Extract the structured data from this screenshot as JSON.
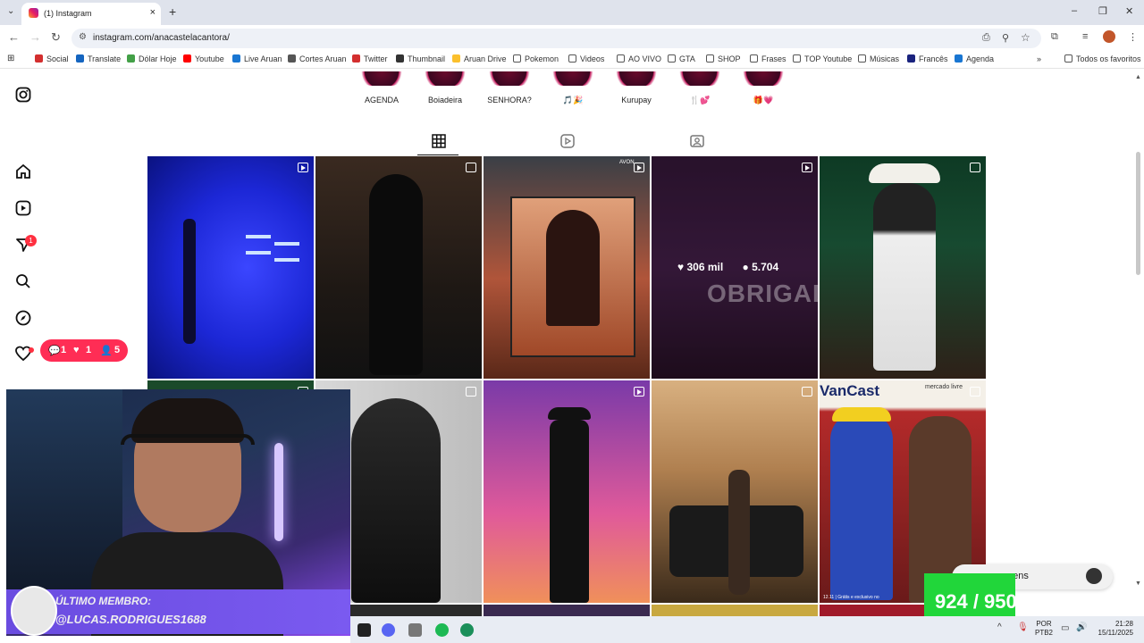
{
  "browser": {
    "tab_title": "(1) Instagram",
    "url": "instagram.com/anacastelacantora/",
    "bookmarks": [
      "Social",
      "Translate",
      "Dólar Hoje",
      "Youtube",
      "Live Aruan",
      "Cortes Aruan",
      "Twitter",
      "Thumbnail",
      "Aruan Drive",
      "Pokemon",
      "Videos",
      "AO VIVO",
      "GTA",
      "SHOP",
      "Frases",
      "TOP Youtube",
      "Músicas",
      "Francês",
      "Agenda"
    ],
    "all_bookmarks": "Todos os favoritos",
    "bookmark_colors": [
      "#d32f2f",
      "#1565c0",
      "#43a047",
      "#ff0000",
      "#1976d2",
      "#555",
      "#d32f2f",
      "#333",
      "#fbc02d",
      "#555",
      "#555",
      "#555",
      "#555",
      "#555",
      "#555",
      "#555",
      "#555",
      "#1a237e",
      "#1976d2"
    ]
  },
  "profile": {
    "highlights": [
      {
        "label": "AGENDA"
      },
      {
        "label": "Boiadeira"
      },
      {
        "label": "SENHORA?"
      },
      {
        "label": "🎵🎉"
      },
      {
        "label": "Kurupay"
      },
      {
        "label": "🍴💕"
      },
      {
        "label": "🎁💗"
      }
    ],
    "tabs": [
      "posts-grid",
      "reels",
      "tagged"
    ],
    "hover_post": {
      "likes": "306 mil",
      "comments": "5.704"
    }
  },
  "grid": {
    "posts": [
      {
        "type": "reel",
        "bg": "#1c27d6"
      },
      {
        "type": "carousel",
        "bg": "#2b2420"
      },
      {
        "type": "reel",
        "bg": "#8b4a2a",
        "brand": "AVON"
      },
      {
        "type": "reel",
        "bg": "#4a2250",
        "overlay_text": "OBRIGADA"
      },
      {
        "type": "carousel",
        "bg": "#0e3a24"
      },
      {
        "type": "reel",
        "bg": "#1a4a2a"
      },
      {
        "type": "carousel",
        "bg": "#cfcfcf"
      },
      {
        "type": "reel",
        "bg": "#e05a9a"
      },
      {
        "type": "carousel",
        "bg": "#b08050"
      },
      {
        "type": "reel",
        "bg": "#b42a2a",
        "title": "VanCast",
        "sponsor": "mercado livre",
        "footer": "12.11 | Grátis e exclusivo no"
      }
    ]
  },
  "notifications": {
    "comments": "1",
    "likes": "1",
    "follows": "5"
  },
  "rail": {
    "badge": "1"
  },
  "overlay": {
    "member_label": "ÚLTIMO MEMBRO:",
    "member_name": "@LUCAS.RODRIGUES1688",
    "counter": "924 / 950",
    "message_pill": "gens"
  },
  "taskbar": {
    "lang_top": "POR",
    "lang_bottom": "PTB2",
    "time": "21:28",
    "date": "15/11/2025"
  }
}
